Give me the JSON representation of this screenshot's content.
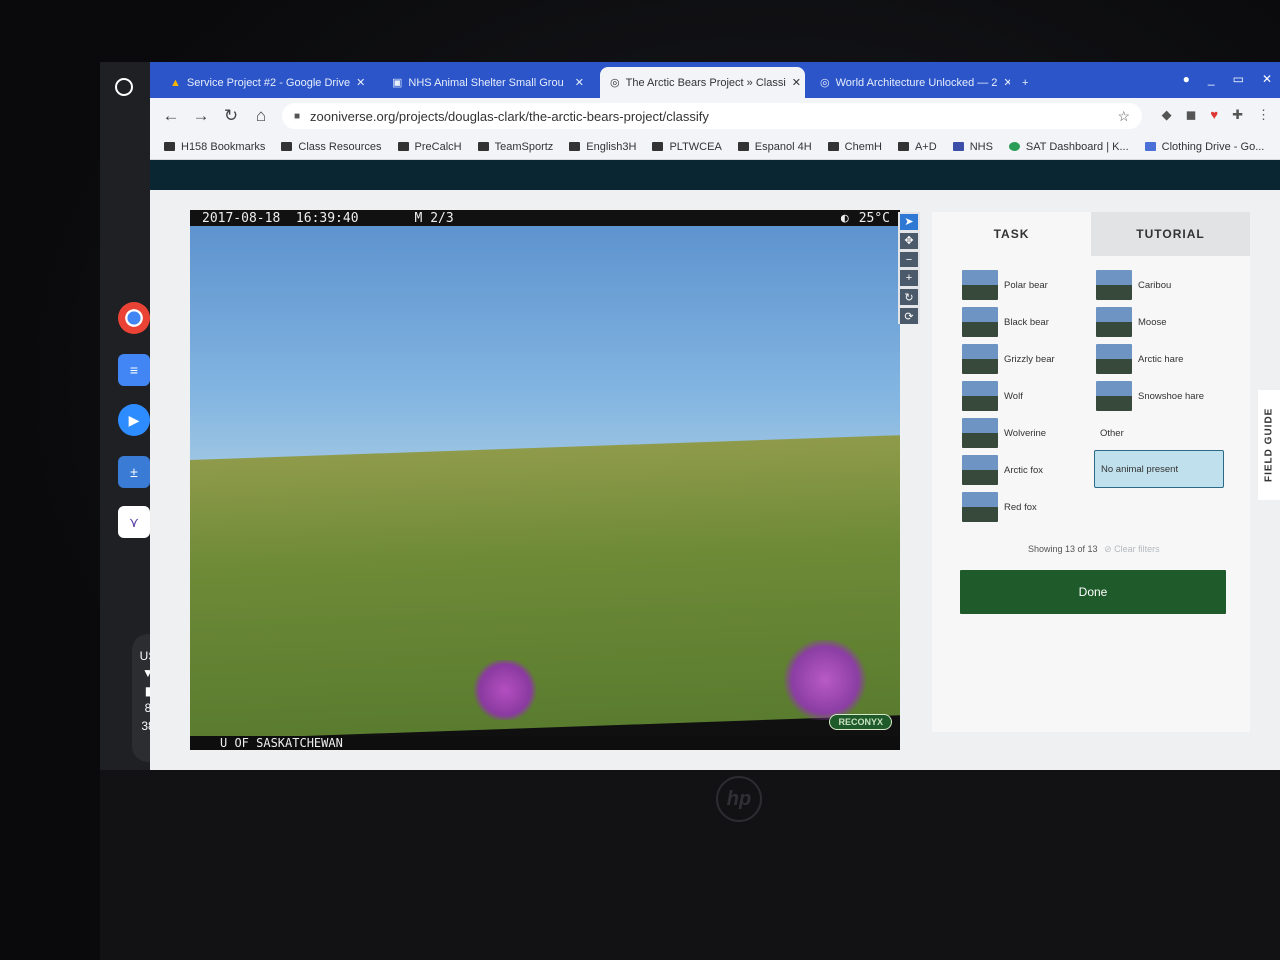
{
  "browser": {
    "tabs": [
      {
        "label": "Service Project #2 - Google Drive"
      },
      {
        "label": "NHS Animal Shelter Small Grou"
      },
      {
        "label": "The Arctic Bears Project » Classi"
      },
      {
        "label": "World Architecture Unlocked — 2"
      }
    ],
    "url": "zooniverse.org/projects/douglas-clark/the-arctic-bears-project/classify",
    "bookmarks": [
      "H158 Bookmarks",
      "Class Resources",
      "PreCalcH",
      "TeamSportz",
      "English3H",
      "PLTWCEA",
      "Espanol 4H",
      "ChemH",
      "A+D",
      "NHS",
      "SAT Dashboard | K...",
      "Clothing Drive - Go..."
    ]
  },
  "shelf": {
    "ime": "US",
    "time_hour": "8",
    "time_min": "38"
  },
  "camera": {
    "datetime": "2017-08-18  16:39:40",
    "frame": "M 2/3",
    "temperature": "25°C",
    "caption": "U OF SASKATCHEWAN",
    "brand": "RECONYX"
  },
  "panel": {
    "tab_task": "TASK",
    "tab_tutorial": "TUTORIAL",
    "choices_left": [
      "Polar bear",
      "Black bear",
      "Grizzly bear",
      "Wolf",
      "Wolverine",
      "Arctic fox",
      "Red fox"
    ],
    "choices_right": [
      "Caribou",
      "Moose",
      "Arctic hare",
      "Snowshoe hare"
    ],
    "other_label": "Other",
    "no_animal_label": "No animal present",
    "showing": "Showing 13 of 13",
    "clear_filters": "Clear filters",
    "done_label": "Done",
    "field_guide": "FIELD GUIDE"
  },
  "colors": {
    "tab_bar": "#2b55c9",
    "done_green": "#1f5b2a",
    "selected_choice": "#bfe0ec"
  }
}
